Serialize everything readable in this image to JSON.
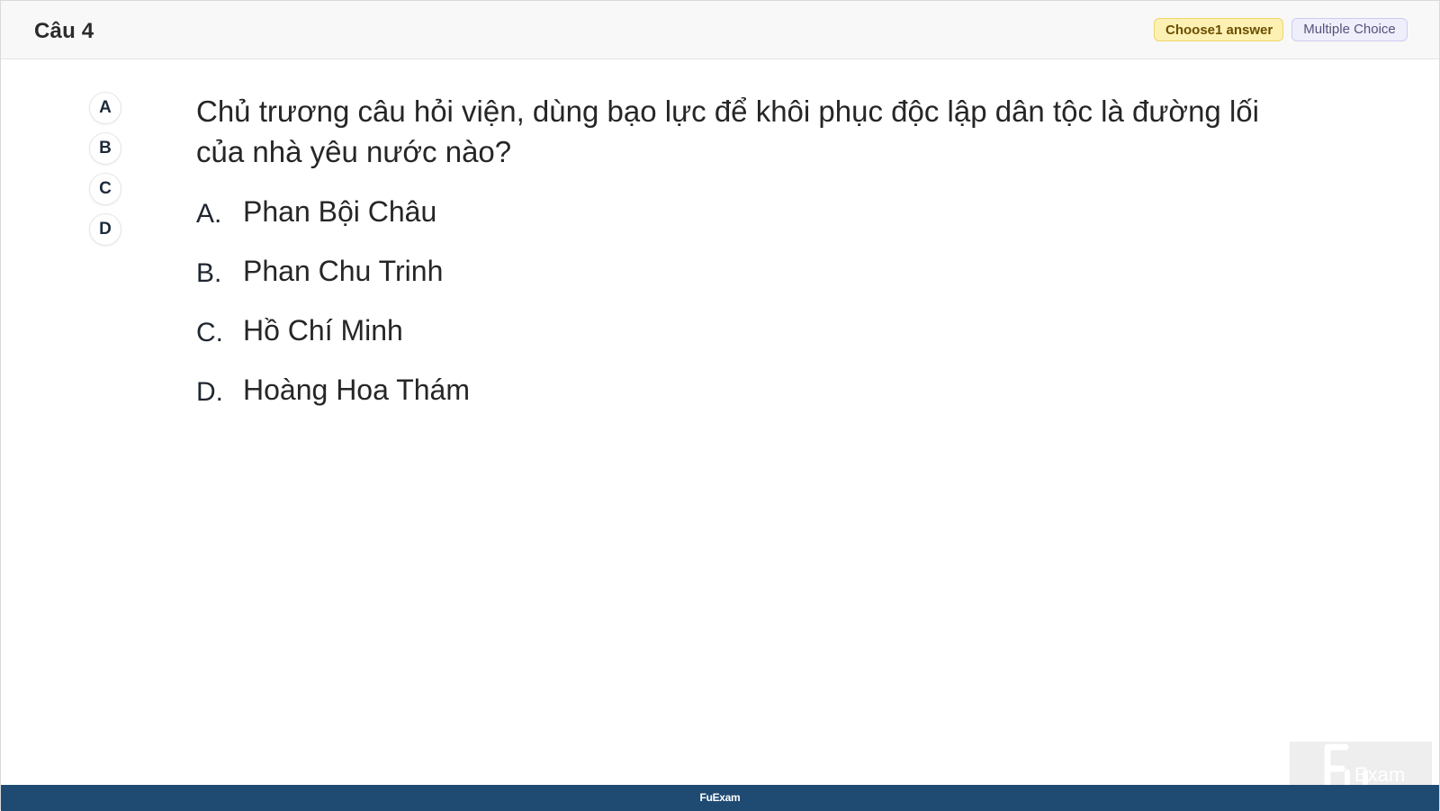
{
  "header": {
    "title": "Câu 4",
    "choose_badge": "Choose1 answer",
    "type_badge": "Multiple Choice"
  },
  "side_options": [
    "A",
    "B",
    "C",
    "D"
  ],
  "question": {
    "text": "Chủ trương câu hỏi viện, dùng bạo lực để khôi phục độc lập dân tộc là đường lối của nhà yêu nước nào?"
  },
  "answers": [
    {
      "letter": "A.",
      "text": "Phan Bội Châu"
    },
    {
      "letter": "B.",
      "text": "Phan Chu Trinh"
    },
    {
      "letter": "C.",
      "text": "Hồ Chí Minh"
    },
    {
      "letter": "D.",
      "text": "Hoàng Hoa Thám"
    }
  ],
  "footer": {
    "label": "FuExam"
  },
  "watermark": {
    "letters": "F",
    "text": "Exam"
  },
  "colors": {
    "footer_bg": "#1f4b73",
    "choose_badge_bg": "#fdf0b3",
    "type_badge_bg": "#efeefb"
  }
}
